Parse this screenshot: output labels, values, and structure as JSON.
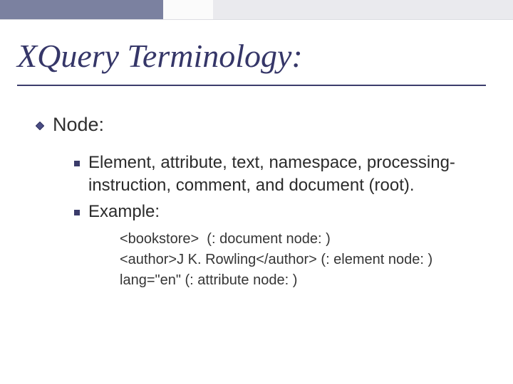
{
  "title": "XQuery Terminology:",
  "level1": {
    "label": "Node:"
  },
  "level2": {
    "items": [
      "Element, attribute, text, namespace, processing-instruction, comment, and document (root).",
      "Example:"
    ]
  },
  "examples": {
    "lines": [
      "<bookstore>  (: document node: )",
      "<author>J K. Rowling</author> (: element node: )",
      "lang=\"en\" (: attribute node: )"
    ]
  },
  "colors": {
    "accent": "#373a6c"
  }
}
